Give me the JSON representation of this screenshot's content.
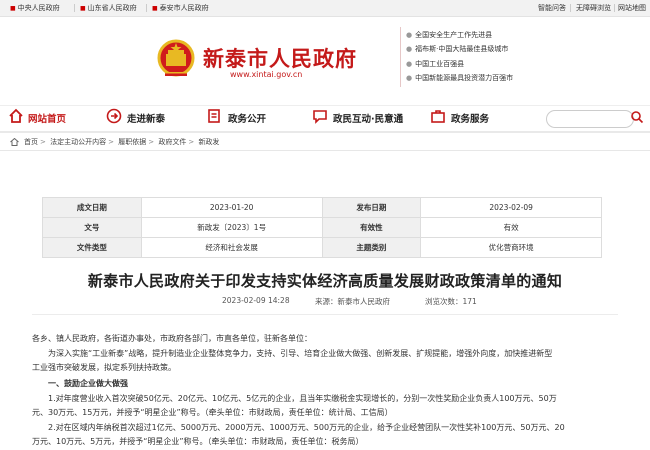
{
  "topbar": {
    "links": [
      "中央人民政府",
      "山东省人民政府",
      "泰安市人民政府"
    ],
    "right": [
      "智能问答",
      "无障碍浏览",
      "网站地图"
    ]
  },
  "header": {
    "title": "新泰市人民政府",
    "url": "www.xintai.gov.cn",
    "honors": [
      "全国安全生产工作先进县",
      "福布斯·中国大陆最佳县级城市",
      "中国工业百强县",
      "中国新能源最具投资潜力百强市"
    ]
  },
  "nav": {
    "items": [
      "网站首页",
      "走进新泰",
      "政务公开",
      "政民互动·民意通",
      "政务服务"
    ],
    "search_placeholder": ""
  },
  "breadcrumb": [
    "首页",
    "法定主动公开内容",
    "履职依据",
    "政府文件",
    "新政发"
  ],
  "meta": {
    "rows": [
      [
        "成文日期",
        "2023-01-20",
        "发布日期",
        "2023-02-09"
      ],
      [
        "文号",
        "新政发〔2023〕1号",
        "有效性",
        "有效"
      ],
      [
        "文件类型",
        "经济和社会发展",
        "主题类别",
        "优化营商环境"
      ]
    ]
  },
  "document": {
    "title": "新泰市人民政府关于印发支持实体经济高质量发展财政政策清单的通知",
    "date": "2023-02-09 14:28",
    "source": "来源：新泰市人民政府",
    "views": "浏览次数：171",
    "paragraphs": [
      "各乡、镇人民政府，各街道办事处，市政府各部门，市直各单位，驻新各单位：",
      "　　为深入实施“工业新泰”战略，提升制造业企业整体竞争力，支持、引导、培育企业做大做强、创新发展、扩规提能，增强外向度，加快推进新型",
      "工业强市突破发展，拟定系列扶持政策。",
      "　　一、鼓励企业做大做强",
      "　　1.对年度营业收入首次突破50亿元、20亿元、10亿元、5亿元的企业，且当年实缴税金实现增长的，分别一次性奖励企业负责人100万元、50万",
      "元、30万元、15万元，并授予“明星企业”称号。（牵头单位：市财政局，责任单位：统计局、工信局）",
      "　　2.对在区域内年纳税首次超过1亿元、5000万元、2000万元、1000万元、500万元的企业，给予企业经营团队一次性奖补100万元、50万元、20",
      "万元、10万元、5万元，并授予“明星企业”称号。（牵头单位：市财政局，责任单位：税务局）"
    ]
  }
}
